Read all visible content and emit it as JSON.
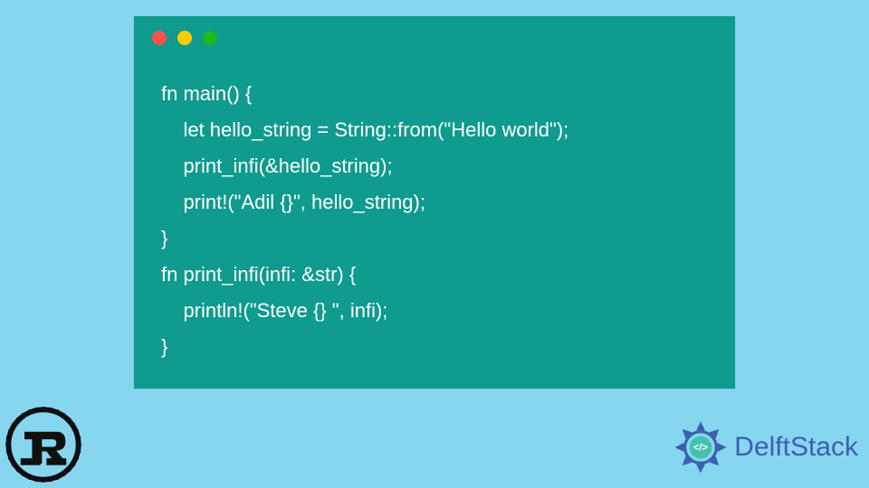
{
  "traffic_light_colors": {
    "red": "#ff5349",
    "yellow": "#ffcc00",
    "green": "#1db91d"
  },
  "code": {
    "language": "rust",
    "line1": "fn main() {",
    "line2": "    let hello_string = String::from(\"Hello world\");",
    "line3": "    print_infi(&hello_string);",
    "line4": "    print!(\"Adil {}\", hello_string);",
    "line5": "}",
    "line6": "fn print_infi(infi: &str) {",
    "line7": "    println!(\"Steve {} \", infi);",
    "line8": "}"
  },
  "brand": {
    "name": "DelftStack"
  },
  "logos": {
    "left": "rust-logo",
    "right": "delftstack-logo"
  },
  "colors": {
    "page_bg": "#87d6f0",
    "card_bg": "#0f9b8e",
    "code_fg": "#ffffff",
    "brand_fg": "#3a5fb0"
  }
}
